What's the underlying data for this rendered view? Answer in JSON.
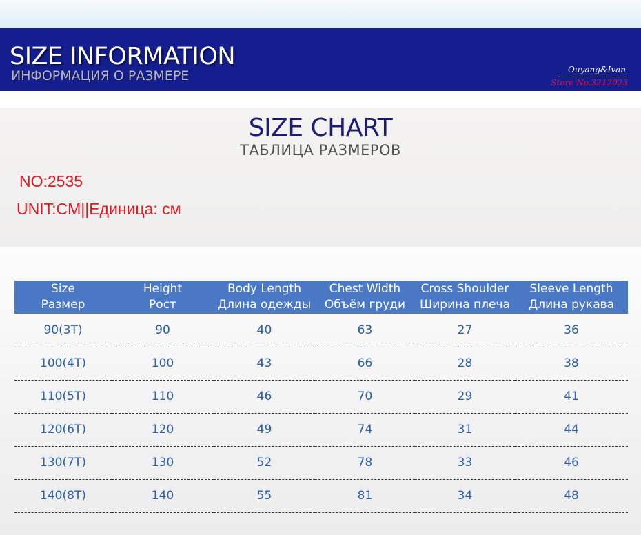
{
  "banner": {
    "title": "SIZE INFORMATION",
    "subtitle": "ИНФОРМАЦИЯ О РАЗМЕРЕ",
    "brand": "Ouyang&Ivan",
    "store": "Store No.3212023"
  },
  "chart": {
    "title": "SIZE CHART",
    "subtitle": "ТАБЛИЦА РАЗМЕРОВ",
    "model_no": "NO:2535",
    "unit": "UNIT:CM||Единица: см"
  },
  "colors": {
    "banner_bg": "#141e8f",
    "header_row_bg": "#4a78c5",
    "value_text": "#2d5fa8",
    "alert_red": "#e8171f",
    "store_red": "#e0154a"
  },
  "table": {
    "headers": [
      {
        "en": "Size",
        "ru": "Размер"
      },
      {
        "en": "Height",
        "ru": "Рост"
      },
      {
        "en": "Body Length",
        "ru": "Длина одежды"
      },
      {
        "en": "Chest Width",
        "ru": "Объём груди"
      },
      {
        "en": "Cross Shoulder",
        "ru": "Ширина плеча"
      },
      {
        "en": "Sleeve Length",
        "ru": "Длина рукава"
      }
    ],
    "rows": [
      [
        "90(3T)",
        "90",
        "40",
        "63",
        "27",
        "36"
      ],
      [
        "100(4T)",
        "100",
        "43",
        "66",
        "28",
        "38"
      ],
      [
        "110(5T)",
        "110",
        "46",
        "70",
        "29",
        "41"
      ],
      [
        "120(6T)",
        "120",
        "49",
        "74",
        "31",
        "44"
      ],
      [
        "130(7T)",
        "130",
        "52",
        "78",
        "33",
        "46"
      ],
      [
        "140(8T)",
        "140",
        "55",
        "81",
        "34",
        "48"
      ]
    ]
  }
}
